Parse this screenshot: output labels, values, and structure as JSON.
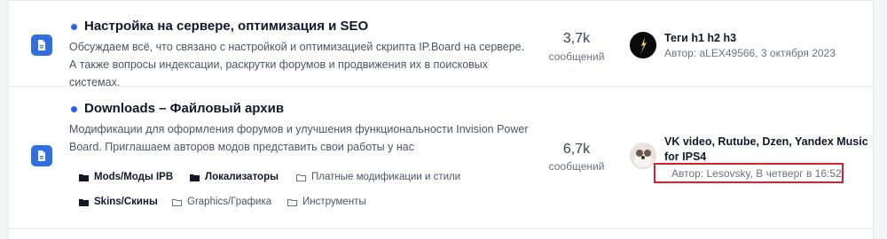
{
  "forums": [
    {
      "title": "Настройка на сервере, оптимизация и SEO",
      "description": "Обсуждаем всё, что связано с настройкой и оптимизацией скрипта IP.Board на сервере. А также вопросы индексации, раскрутки форумов и продвижения их в поисковых системах.",
      "posts_count": "3,7k",
      "posts_label": "сообщений",
      "last_post": {
        "title": "Теги h1 h2 h3",
        "meta": "Автор: aLEX49566, 3 октября 2023"
      }
    },
    {
      "title": "Downloads – Файловый архив",
      "description": "Модификации для оформления форумов и улучшения функциональности Invision Power Board. Приглашаем авторов модов представить свои работы у нас",
      "posts_count": "6,7k",
      "posts_label": "сообщений",
      "last_post": {
        "title": "VK video, Rutube, Dzen, Yandex Music for IPS4",
        "meta": "Автор: Lesovsky, В четверг в 16:52"
      },
      "subforums": [
        {
          "label": "Mods/Моды IPB",
          "unread": true
        },
        {
          "label": "Локализаторы",
          "unread": true
        },
        {
          "label": "Платные модификации и стили",
          "unread": false
        },
        {
          "label": "Skins/Скины",
          "unread": true
        },
        {
          "label": "Graphics/Графика",
          "unread": false
        },
        {
          "label": "Инструменты",
          "unread": false
        }
      ]
    }
  ],
  "colors": {
    "accent": "#2f6fe0",
    "highlight": "#e11d2b"
  },
  "icons": {
    "forum": "document-icon",
    "subforum_unread": "folder-filled-icon",
    "subforum_read": "folder-outline-icon"
  }
}
